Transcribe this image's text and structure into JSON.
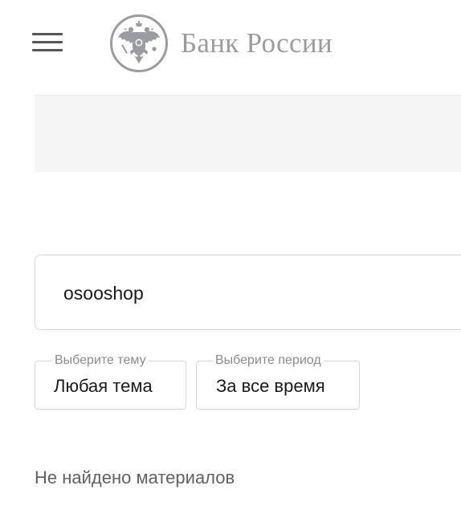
{
  "header": {
    "menu_icon": "hamburger-menu-icon",
    "logo": {
      "emblem_icon": "double-headed-eagle-emblem-icon",
      "text": "Банк России",
      "color": "#9a9ba3"
    }
  },
  "search": {
    "value": "osooshop"
  },
  "filters": {
    "topic": {
      "legend": "Выберите тему",
      "value": "Любая тема"
    },
    "period": {
      "legend": "Выберите период",
      "value": "За все время"
    }
  },
  "results": {
    "empty_message": "Не найдено материалов"
  },
  "colors": {
    "border": "#d6d6d9",
    "banner_bg": "#f5f5f5",
    "muted_text": "#8b8b92"
  }
}
